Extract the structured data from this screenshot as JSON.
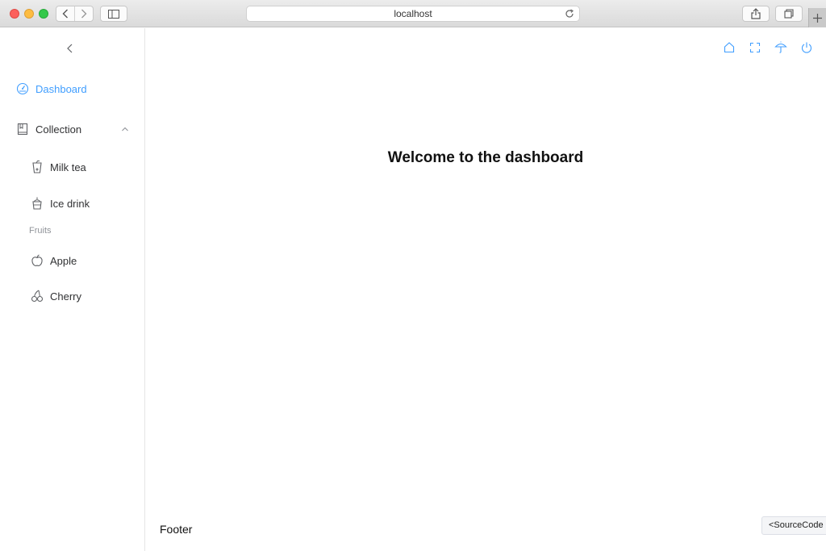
{
  "browser": {
    "url": "localhost",
    "icons": [
      "back-icon",
      "forward-icon",
      "sidebar-toggle-icon",
      "reload-icon",
      "share-icon",
      "tabs-icon",
      "new-tab-icon"
    ]
  },
  "sidebar": {
    "items": [
      {
        "label": "Dashboard",
        "icon": "dashboard-icon",
        "active": true
      },
      {
        "label": "Collection",
        "icon": "collection-icon",
        "expanded": true
      },
      {
        "label": "Milk tea",
        "icon": "milk-tea-icon"
      },
      {
        "label": "Ice drink",
        "icon": "ice-drink-icon"
      },
      {
        "label": "Apple",
        "icon": "apple-icon"
      },
      {
        "label": "Cherry",
        "icon": "cherry-icon"
      }
    ],
    "group_label": "Fruits"
  },
  "header": {
    "icons": [
      "home-icon",
      "fullscreen-icon",
      "umbrella-icon",
      "power-icon"
    ]
  },
  "main": {
    "title": "Welcome to the dashboard",
    "footer": "Footer",
    "source_button": "<SourceCode"
  },
  "colors": {
    "accent": "#409eff",
    "text": "#303133",
    "muted": "#909399"
  }
}
